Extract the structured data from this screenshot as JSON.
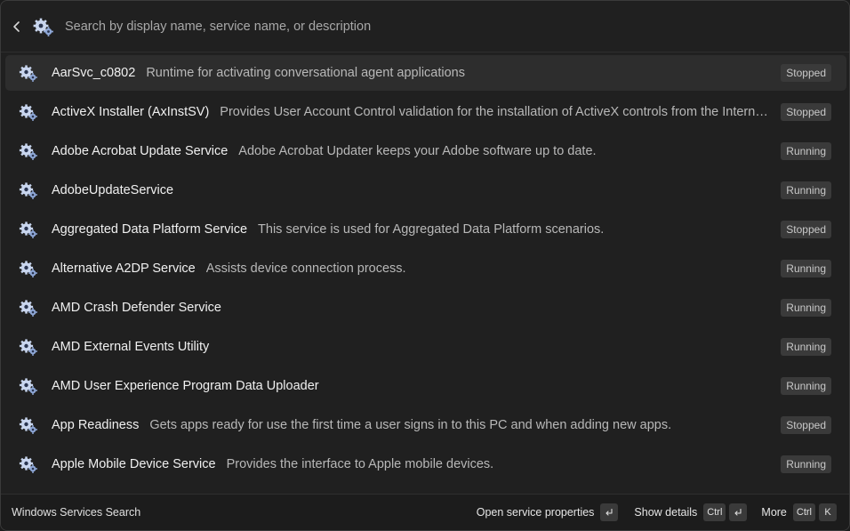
{
  "search": {
    "placeholder": "Search by display name, service name, or description",
    "value": ""
  },
  "icons": {
    "back": "chevron-left-icon",
    "extension": "gears-icon",
    "service": "gear-icon",
    "enter": "enter-key-icon"
  },
  "colors": {
    "background": "#202020",
    "selected_row": "#2d2d2d",
    "badge_bg": "#3a3a3a",
    "gear_color": "#c9d6ef"
  },
  "services": [
    {
      "name": "AarSvc_c0802",
      "description": "Runtime for activating conversational agent applications",
      "status": "Stopped",
      "selected": true
    },
    {
      "name": "ActiveX Installer (AxInstSV)",
      "description": "Provides User Account Control validation for the installation of ActiveX controls from the Internet and enables management of ActiveX control installation based on Group Policy settings.",
      "status": "Stopped"
    },
    {
      "name": "Adobe Acrobat Update Service",
      "description": "Adobe Acrobat Updater keeps your Adobe software up to date.",
      "status": "Running"
    },
    {
      "name": "AdobeUpdateService",
      "description": "",
      "status": "Running"
    },
    {
      "name": "Aggregated Data Platform Service",
      "description": "This service is used for Aggregated Data Platform scenarios.",
      "status": "Stopped"
    },
    {
      "name": "Alternative A2DP Service",
      "description": "Assists device connection process.",
      "status": "Running"
    },
    {
      "name": "AMD Crash Defender Service",
      "description": "",
      "status": "Running"
    },
    {
      "name": "AMD External Events Utility",
      "description": "",
      "status": "Running"
    },
    {
      "name": "AMD User Experience Program Data Uploader",
      "description": "",
      "status": "Running"
    },
    {
      "name": "App Readiness",
      "description": "Gets apps ready for use the first time a user signs in to this PC and when adding new apps.",
      "status": "Stopped"
    },
    {
      "name": "Apple Mobile Device Service",
      "description": "Provides the interface to Apple mobile devices.",
      "status": "Running"
    }
  ],
  "footer": {
    "title": "Windows Services Search",
    "primary_action": {
      "label": "Open service properties",
      "keys": [
        "enter"
      ]
    },
    "secondary_action": {
      "label": "Show details",
      "keys": [
        "Ctrl",
        "enter"
      ]
    },
    "more": {
      "label": "More",
      "keys": [
        "Ctrl",
        "K"
      ]
    }
  }
}
